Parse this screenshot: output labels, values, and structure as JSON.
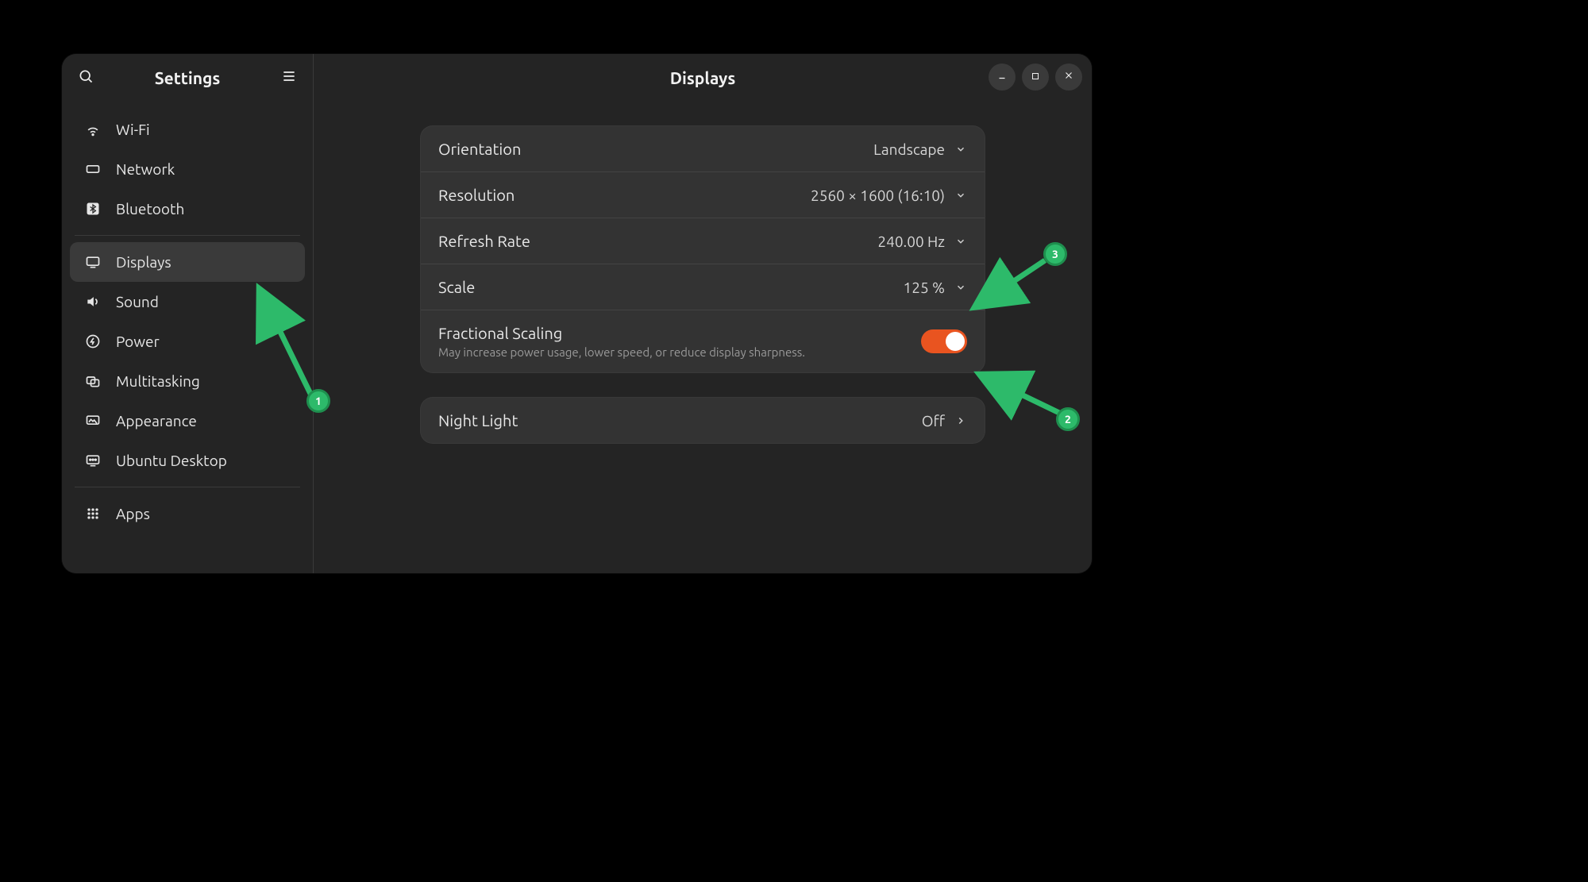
{
  "sidebar": {
    "title": "Settings",
    "items": [
      {
        "key": "wifi",
        "label": "Wi-Fi"
      },
      {
        "key": "network",
        "label": "Network"
      },
      {
        "key": "bluetooth",
        "label": "Bluetooth"
      },
      {
        "key": "displays",
        "label": "Displays",
        "selected": true
      },
      {
        "key": "sound",
        "label": "Sound"
      },
      {
        "key": "power",
        "label": "Power"
      },
      {
        "key": "multitasking",
        "label": "Multitasking"
      },
      {
        "key": "appearance",
        "label": "Appearance"
      },
      {
        "key": "ubuntu",
        "label": "Ubuntu Desktop"
      },
      {
        "key": "apps",
        "label": "Apps"
      }
    ]
  },
  "content": {
    "title": "Displays",
    "rows": {
      "orientation": {
        "label": "Orientation",
        "value": "Landscape"
      },
      "resolution": {
        "label": "Resolution",
        "value": "2560 × 1600 (16:10)"
      },
      "refresh": {
        "label": "Refresh Rate",
        "value": "240.00 Hz"
      },
      "scale": {
        "label": "Scale",
        "value": "125 %"
      },
      "fractional": {
        "label": "Fractional Scaling",
        "sub": "May increase power usage, lower speed, or reduce display sharpness.",
        "on": true
      },
      "nightlight": {
        "label": "Night Light",
        "value": "Off"
      }
    }
  },
  "annotations": {
    "1": "1",
    "2": "2",
    "3": "3"
  },
  "colors": {
    "accent": "#e95420",
    "annotation": "#2dba6a"
  }
}
